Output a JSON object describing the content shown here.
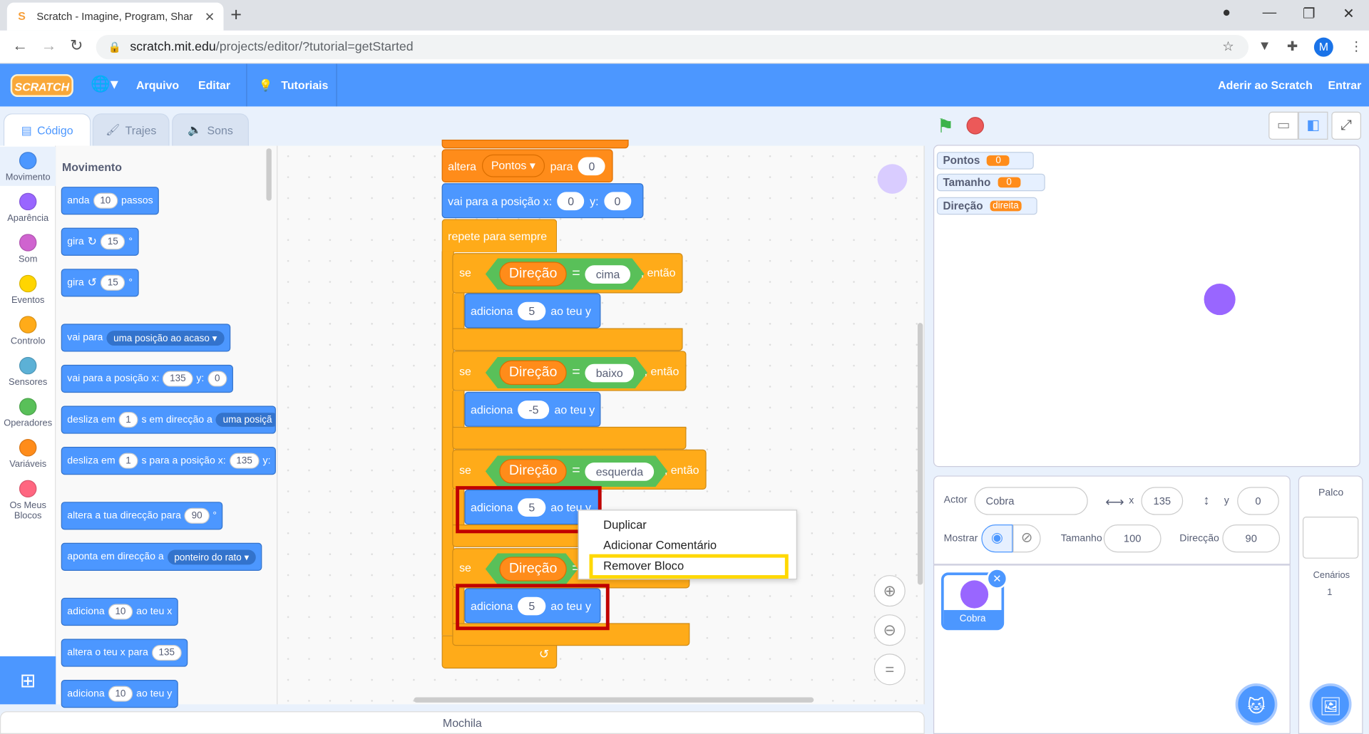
{
  "browser": {
    "tab_title": "Scratch - Imagine, Program, Shar",
    "tab_favicon": "S",
    "tab_close": "✕",
    "new_tab": "+",
    "url_host": "scratch.mit.edu",
    "url_path": "/projects/editor/?tutorial=getStarted",
    "avatar_letter": "M"
  },
  "menu": {
    "logo": "SCRATCH",
    "arquivo": "Arquivo",
    "editar": "Editar",
    "tutoriais": "Tutoriais",
    "aderir": "Aderir ao Scratch",
    "entrar": "Entrar"
  },
  "editor_tabs": {
    "codigo": "Código",
    "trajes": "Trajes",
    "sons": "Sons"
  },
  "categories": [
    {
      "label": "Movimento",
      "color": "#4c97ff"
    },
    {
      "label": "Aparência",
      "color": "#9966ff"
    },
    {
      "label": "Som",
      "color": "#cf63cf"
    },
    {
      "label": "Eventos",
      "color": "#ffd500"
    },
    {
      "label": "Controlo",
      "color": "#ffab19"
    },
    {
      "label": "Sensores",
      "color": "#5cb1d6"
    },
    {
      "label": "Operadores",
      "color": "#59c059"
    },
    {
      "label": "Variáveis",
      "color": "#ff8c1a"
    },
    {
      "label": "Os Meus Blocos",
      "color": "#ff6680"
    }
  ],
  "palette": {
    "title": "Movimento",
    "b1": {
      "a": "anda",
      "v": "10",
      "b": "passos"
    },
    "b2": {
      "a": "gira",
      "v": "15",
      "b": "°"
    },
    "b3": {
      "a": "gira",
      "v": "15",
      "b": "°"
    },
    "b4": {
      "a": "vai para",
      "dd": "uma posição ao acaso"
    },
    "b5": {
      "a": "vai para a posição x:",
      "x": "135",
      "y_label": "y:",
      "y": "0"
    },
    "b6": {
      "a": "desliza em",
      "v": "1",
      "b": "s em direcção a",
      "dd": "uma posiçã"
    },
    "b7": {
      "a": "desliza em",
      "v": "1",
      "b": "s para a posição x:",
      "x": "135",
      "y_label": "y:"
    },
    "b8": {
      "a": "altera a tua direcção para",
      "v": "90",
      "b": "°"
    },
    "b9": {
      "a": "aponta em direcção a",
      "dd": "ponteiro do rato"
    },
    "b10": {
      "a": "adiciona",
      "v": "10",
      "b": "ao teu x"
    },
    "b11": {
      "a": "altera o teu x para",
      "v": "135"
    },
    "b12": {
      "a": "adiciona",
      "v": "10",
      "b": "ao teu y"
    }
  },
  "script": {
    "altera": "altera",
    "pontos": "Pontos",
    "para": "para",
    "zero": "0",
    "vai_para": "vai para a posição x:",
    "y_label": "y:",
    "repete": "repete para sempre",
    "se": "se",
    "entao": ", então",
    "direcao": "Direção",
    "eq": "=",
    "adiciona": "adiciona",
    "ao_teu_y": "ao teu y",
    "ao_teu_y_clipped": "ao teu y",
    "cima": "cima",
    "baixo": "baixo",
    "esquerda": "esquerda",
    "v5": "5",
    "vm5": "-5"
  },
  "context_menu": {
    "duplicar": "Duplicar",
    "comentario": "Adicionar Comentário",
    "remover": "Remover Bloco"
  },
  "mochila": "Mochila",
  "monitors": [
    {
      "name": "Pontos",
      "value": "0"
    },
    {
      "name": "Tamanho",
      "value": "0"
    },
    {
      "name": "Direção",
      "value": "direita"
    }
  ],
  "sprite_info": {
    "actor_label": "Actor",
    "actor_name": "Cobra",
    "x_label": "x",
    "x": "135",
    "y_label": "y",
    "y": "0",
    "mostrar": "Mostrar",
    "tamanho_label": "Tamanho",
    "tamanho": "100",
    "direccao_label": "Direcção",
    "direccao": "90"
  },
  "sprite_thumb": "Cobra",
  "stage_pane": {
    "palco": "Palco",
    "cenarios": "Cenários",
    "count": "1"
  },
  "colors": {
    "accent": "#4c97ff",
    "sprite": "#9966ff",
    "highlight_red": "#c00000",
    "highlight_yellow": "#ffd800"
  }
}
